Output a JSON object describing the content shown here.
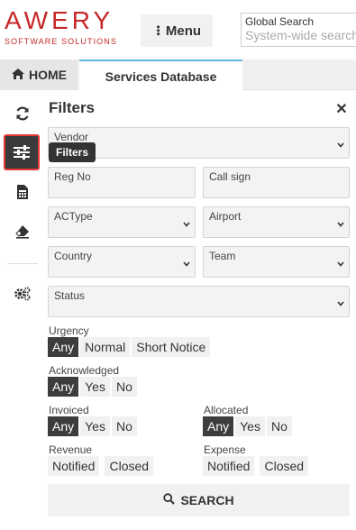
{
  "header": {
    "logo_main": "AWERY",
    "logo_sub": "SOFTWARE SOLUTIONS",
    "menu_label": "Menu",
    "search_label": "Global Search",
    "search_placeholder": "System-wide search"
  },
  "tabs": {
    "home_label": "HOME",
    "active_label": "Services Database"
  },
  "tooltip": "Filters",
  "filters": {
    "title": "Filters",
    "fields": {
      "vendor": "Vendor",
      "reg_no": "Reg No",
      "call_sign": "Call sign",
      "actype": "ACType",
      "airport": "Airport",
      "country": "Country",
      "team": "Team",
      "status": "Status"
    },
    "urgency": {
      "label": "Urgency",
      "options": [
        "Any",
        "Normal",
        "Short Notice"
      ],
      "selected": "Any"
    },
    "acknowledged": {
      "label": "Acknowledged",
      "options": [
        "Any",
        "Yes",
        "No"
      ],
      "selected": "Any"
    },
    "invoiced": {
      "label": "Invoiced",
      "options": [
        "Any",
        "Yes",
        "No"
      ],
      "selected": "Any"
    },
    "allocated": {
      "label": "Allocated",
      "options": [
        "Any",
        "Yes",
        "No"
      ],
      "selected": "Any"
    },
    "revenue": {
      "label": "Revenue",
      "options": [
        "Notified",
        "Closed"
      ]
    },
    "expense": {
      "label": "Expense",
      "options": [
        "Notified",
        "Closed"
      ]
    },
    "search_label": "SEARCH"
  },
  "icons": {
    "toolbar": [
      "refresh-icon",
      "filters-icon",
      "calculator-icon",
      "eraser-icon",
      "settings-icon"
    ]
  },
  "colors": {
    "brand": "#c62828",
    "active_tab_border": "#5fb6e0",
    "highlight_border": "#e53935",
    "selected_option": "#3d3d3d"
  }
}
